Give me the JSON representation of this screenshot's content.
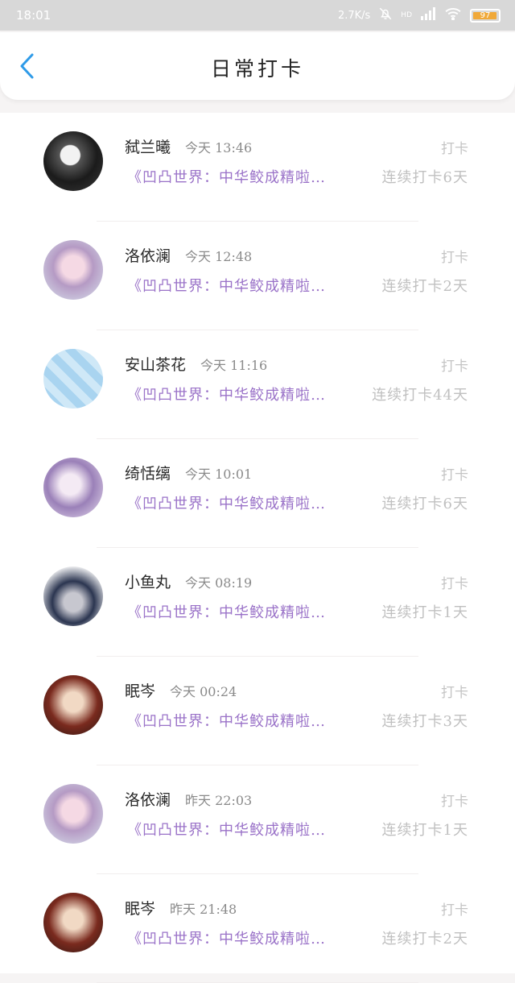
{
  "status_bar": {
    "time": "18:01",
    "net_speed": "2.7K/s",
    "network": "HD",
    "battery": "97",
    "battery_level": 0.97
  },
  "header": {
    "title": "日常打卡",
    "back_icon": "chevron-left-icon"
  },
  "colors": {
    "accent_blue": "#2f9be8",
    "link_purple": "#9a72c8",
    "battery_orange": "#f0a93a"
  },
  "entries": [
    {
      "name": "弑兰曦",
      "time": "今天 13:46",
      "tag": "打卡",
      "post": "《凹凸世界：中华鲛成精啦…",
      "streak": "连续打卡6天"
    },
    {
      "name": "洛依澜",
      "time": "今天 12:48",
      "tag": "打卡",
      "post": "《凹凸世界：中华鲛成精啦…",
      "streak": "连续打卡2天"
    },
    {
      "name": "安山茶花",
      "time": "今天 11:16",
      "tag": "打卡",
      "post": "《凹凸世界：中华鲛成精啦…",
      "streak": "连续打卡44天"
    },
    {
      "name": "绮恬缡",
      "time": "今天 10:01",
      "tag": "打卡",
      "post": "《凹凸世界：中华鲛成精啦…",
      "streak": "连续打卡6天"
    },
    {
      "name": "小鱼丸",
      "time": "今天 08:19",
      "tag": "打卡",
      "post": "《凹凸世界：中华鲛成精啦…",
      "streak": "连续打卡1天"
    },
    {
      "name": "眠岑",
      "time": "今天 00:24",
      "tag": "打卡",
      "post": "《凹凸世界：中华鲛成精啦…",
      "streak": "连续打卡3天"
    },
    {
      "name": "洛依澜",
      "time": "昨天 22:03",
      "tag": "打卡",
      "post": "《凹凸世界：中华鲛成精啦…",
      "streak": "连续打卡1天"
    },
    {
      "name": "眠岑",
      "time": "昨天 21:48",
      "tag": "打卡",
      "post": "《凹凸世界：中华鲛成精啦…",
      "streak": "连续打卡2天"
    }
  ]
}
